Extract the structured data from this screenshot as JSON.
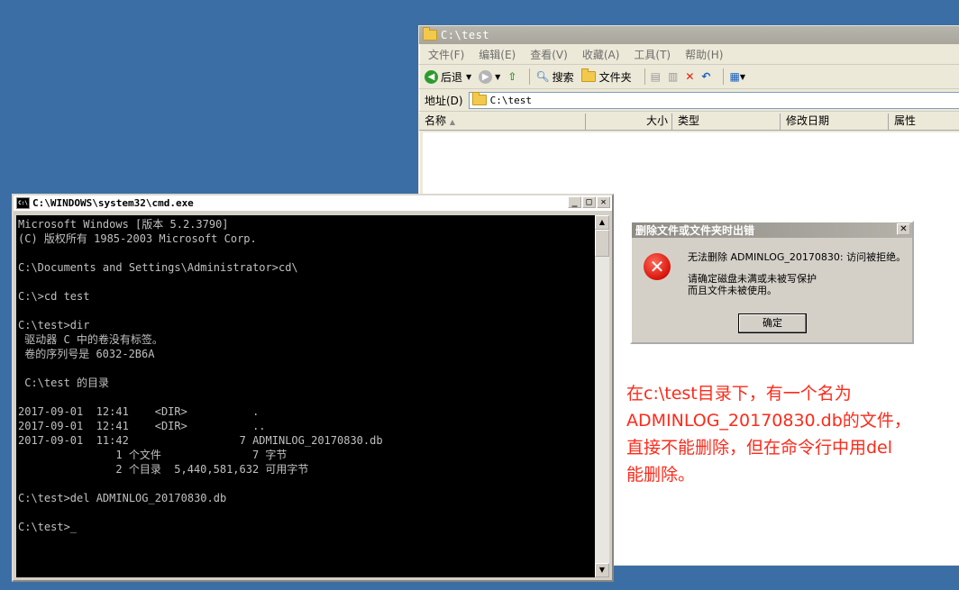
{
  "explorer": {
    "title": "C:\\test",
    "menu": [
      "文件(F)",
      "编辑(E)",
      "查看(V)",
      "收藏(A)",
      "工具(T)",
      "帮助(H)"
    ],
    "toolbar": {
      "back": "后退",
      "search": "搜索",
      "folders": "文件夹"
    },
    "address_label": "地址(D)",
    "address_value": "C:\\test",
    "columns": [
      "名称",
      "大小",
      "类型",
      "修改日期",
      "属性"
    ]
  },
  "cmd": {
    "title": "C:\\WINDOWS\\system32\\cmd.exe",
    "lines": [
      "Microsoft Windows [版本 5.2.3790]",
      "(C) 版权所有 1985-2003 Microsoft Corp.",
      "",
      "C:\\Documents and Settings\\Administrator>cd\\",
      "",
      "C:\\>cd test",
      "",
      "C:\\test>dir",
      " 驱动器 C 中的卷没有标签。",
      " 卷的序列号是 6032-2B6A",
      "",
      " C:\\test 的目录",
      "",
      "2017-09-01  12:41    <DIR>          .",
      "2017-09-01  12:41    <DIR>          ..",
      "2017-09-01  11:42                 7 ADMINLOG_20170830.db",
      "               1 个文件              7 字节",
      "               2 个目录  5,440,581,632 可用字节",
      "",
      "C:\\test>del ADMINLOG_20170830.db",
      "",
      "C:\\test>_"
    ]
  },
  "dialog": {
    "title": "删除文件或文件夹时出错",
    "message": "无法删除 ADMINLOG_20170830: 访问被拒绝。",
    "detail_line1": "请确定磁盘未满或未被写保护",
    "detail_line2": "而且文件未被使用。",
    "ok_label": "确定"
  },
  "annotation": {
    "line1": "在c:\\test目录下，有一个名为",
    "line2": "ADMINLOG_20170830.db的文件，",
    "line3": "直接不能删除，但在命令行中用del",
    "line4": "能删除。"
  }
}
